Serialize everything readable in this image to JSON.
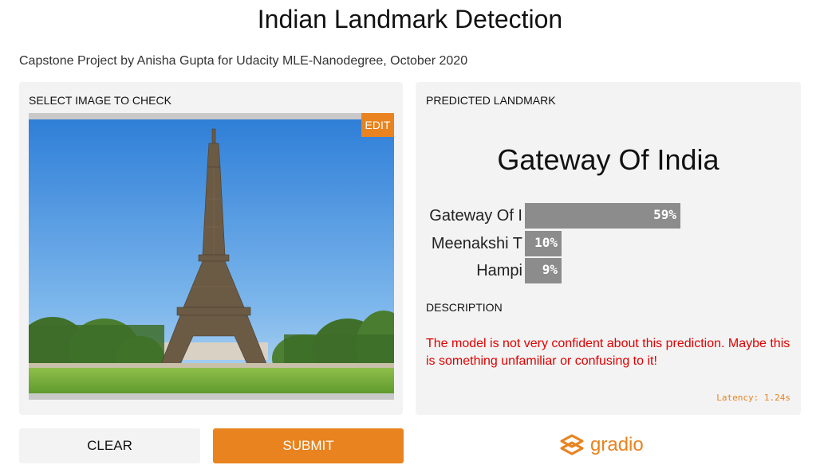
{
  "header": {
    "title": "Indian Landmark Detection",
    "subtitle": "Capstone Project by Anisha Gupta for Udacity MLE-Nanodegree, October 2020"
  },
  "input_panel": {
    "label": "SELECT IMAGE TO CHECK",
    "edit_label": "EDIT"
  },
  "output_panel": {
    "label": "PREDICTED LANDMARK",
    "predicted": "Gateway Of India",
    "confidences": [
      {
        "label": "Gateway Of I",
        "percent_text": "59%",
        "value": 0.59
      },
      {
        "label": "Meenakshi T",
        "percent_text": "10%",
        "value": 0.1
      },
      {
        "label": "Hampi",
        "percent_text": "9%",
        "value": 0.09
      }
    ],
    "description_label": "DESCRIPTION",
    "description": "The model is not very confident about this prediction. Maybe this is something unfamiliar or confusing to it!",
    "latency": "Latency: 1.24s"
  },
  "buttons": {
    "clear": "CLEAR",
    "submit": "SUBMIT"
  },
  "brand": {
    "name": "gradio",
    "color": "#e8831f"
  },
  "colors": {
    "accent": "#e8831f",
    "panel": "#f3f3f3",
    "bar": "#8c8c8c",
    "warning_text": "#e00000"
  }
}
